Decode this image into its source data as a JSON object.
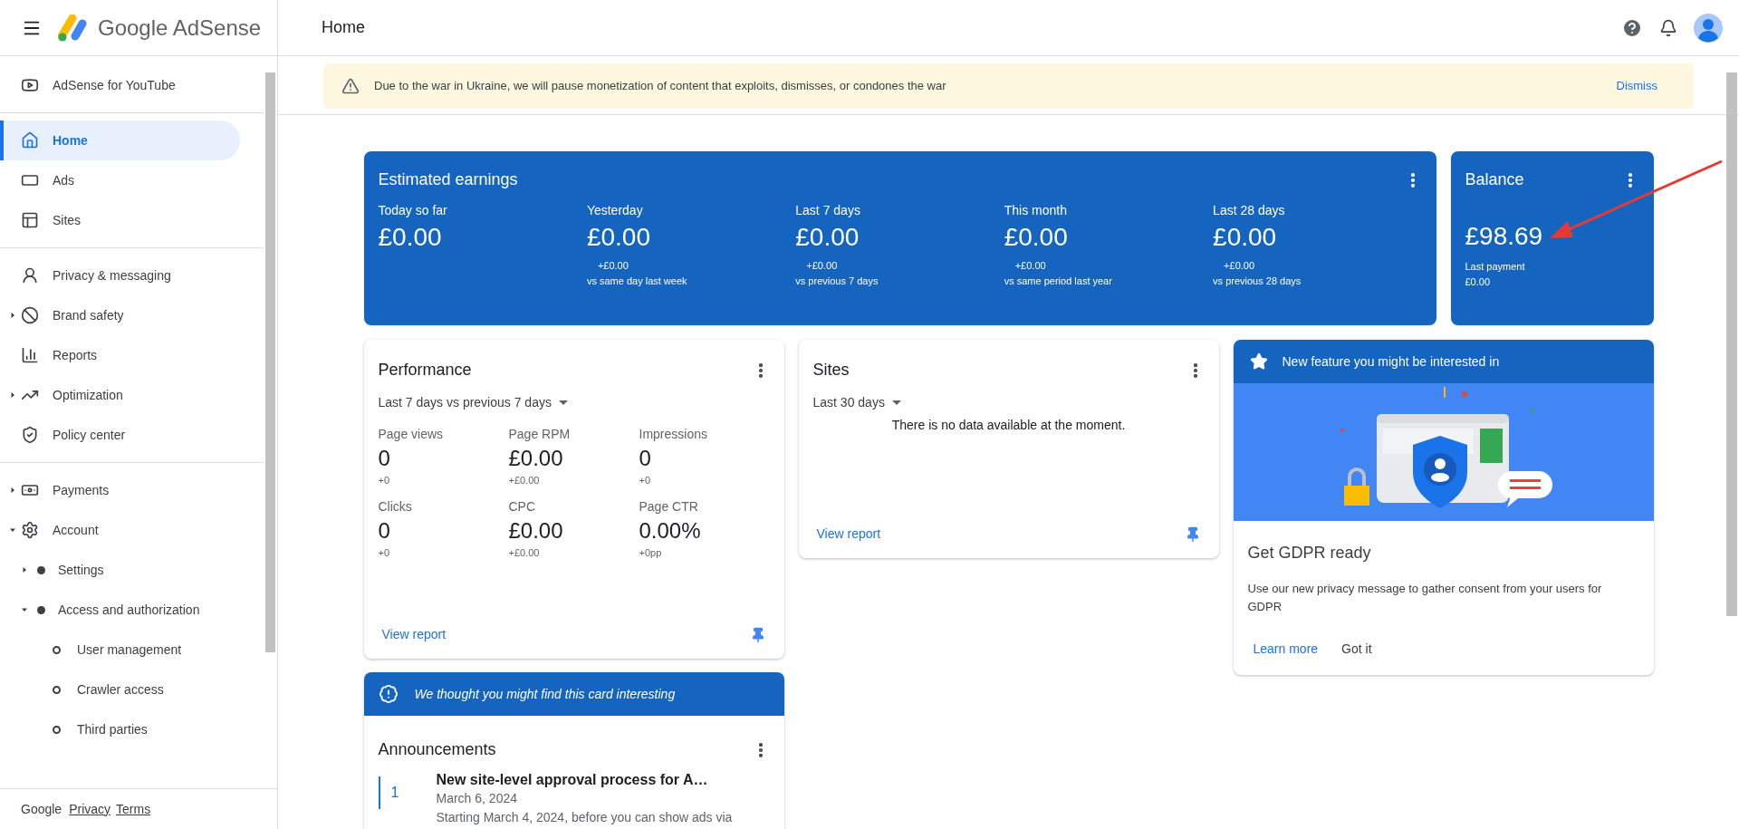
{
  "header": {
    "brand": "Google AdSense",
    "page_title": "Home"
  },
  "sidebar": {
    "groups": [
      [
        {
          "label": "AdSense for YouTube",
          "selected": false
        }
      ],
      [
        {
          "label": "Home",
          "selected": true
        },
        {
          "label": "Ads",
          "selected": false
        },
        {
          "label": "Sites",
          "selected": false
        }
      ],
      [
        {
          "label": "Privacy & messaging",
          "selected": false
        },
        {
          "label": "Brand safety",
          "selected": false,
          "expanded": false
        },
        {
          "label": "Reports",
          "selected": false
        },
        {
          "label": "Optimization",
          "selected": false,
          "expanded": false
        },
        {
          "label": "Policy center",
          "selected": false
        }
      ],
      [
        {
          "label": "Payments",
          "selected": false,
          "expanded": false
        },
        {
          "label": "Account",
          "selected": false,
          "expanded": true,
          "children": [
            {
              "label": "Settings",
              "selected": false,
              "expanded": false
            },
            {
              "label": "Access and authorization",
              "selected": false,
              "expanded": true,
              "children": [
                {
                  "label": "User management",
                  "selected": false
                },
                {
                  "label": "Crawler access",
                  "selected": false
                },
                {
                  "label": "Third parties",
                  "selected": false
                }
              ]
            }
          ]
        }
      ]
    ],
    "footer": {
      "brand": "Google",
      "links": [
        "Privacy",
        "Terms"
      ]
    }
  },
  "notice": {
    "text": "Due to the war in Ukraine, we will pause monetization of content that exploits, dismisses, or condones the war",
    "action": "Dismiss"
  },
  "earnings": {
    "title": "Estimated earnings",
    "metrics": [
      {
        "label": "Today so far",
        "value": "£0.00"
      },
      {
        "label": "Yesterday",
        "value": "£0.00",
        "change": "+£0.00",
        "comparison": "vs same day last week"
      },
      {
        "label": "Last 7 days",
        "value": "£0.00",
        "change": "+£0.00",
        "comparison": "vs previous 7 days"
      },
      {
        "label": "This month",
        "value": "£0.00",
        "change": "+£0.00",
        "comparison": "vs same period last year"
      },
      {
        "label": "Last 28 days",
        "value": "£0.00",
        "change": "+£0.00",
        "comparison": "vs previous 28 days"
      }
    ]
  },
  "balance": {
    "title": "Balance",
    "value": "£98.69",
    "last_payment_label": "Last payment",
    "last_payment_value": "£0.00"
  },
  "performance": {
    "title": "Performance",
    "range": "Last 7 days vs previous 7 days",
    "metrics": [
      {
        "label": "Page views",
        "value": "0",
        "change": "+0"
      },
      {
        "label": "Page RPM",
        "value": "£0.00",
        "change": "+£0.00"
      },
      {
        "label": "Impressions",
        "value": "0",
        "change": "+0"
      },
      {
        "label": "Clicks",
        "value": "0",
        "change": "+0"
      },
      {
        "label": "CPC",
        "value": "£0.00",
        "change": "+£0.00"
      },
      {
        "label": "Page CTR",
        "value": "0.00%",
        "change": "+0pp"
      }
    ],
    "link": "View report"
  },
  "sites": {
    "title": "Sites",
    "range": "Last 30 days",
    "empty_text": "There is no data available at the moment.",
    "link": "View report"
  },
  "feature": {
    "banner": "New feature you might be interested in",
    "title": "Get GDPR ready",
    "body": "Use our new privacy message to gather consent from your users for GDPR",
    "actions": [
      "Learn more",
      "Got it"
    ]
  },
  "announcements": {
    "banner": "We thought you might find this card interesting",
    "title": "Announcements",
    "items": [
      {
        "number": "1",
        "title": "New site-level approval process for A…",
        "date": "March 6, 2024",
        "text": "Starting March 4, 2024, before you can show ads via"
      }
    ]
  }
}
